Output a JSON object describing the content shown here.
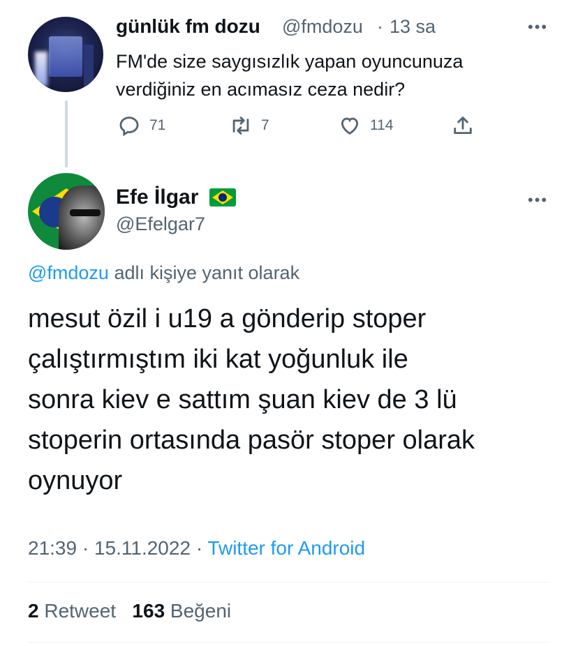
{
  "parent_tweet": {
    "display_name": "günlük fm dozu",
    "handle": "@fmdozu",
    "separator": "·",
    "time": "13 sa",
    "more_icon": "more-icon",
    "text_line1": "FM'de size saygısızlık yapan oyuncunuza",
    "text_line2": "verdiğiniz en acımasız ceza nedir?",
    "actions": {
      "reply_count": "71",
      "retweet_count": "7",
      "like_count": "114"
    }
  },
  "main_tweet": {
    "display_name": "Efe İlgar",
    "flag_icon": "brazil-flag-icon",
    "handle": "@Efelgar7",
    "reply_to_handle": "@fmdozu",
    "reply_to_suffix": " adlı kişiye yanıt olarak",
    "text_lines": [
      "mesut özil i u19 a gönderip stoper",
      "çalıştırmıştım iki kat yoğunluk ile",
      "sonra kiev e sattım şuan kiev de 3 lü",
      "stoperin ortasında pasör stoper olarak",
      "oynuyor"
    ],
    "time": "21:39",
    "date": "15.11.2022",
    "separator": "·",
    "source": "Twitter for Android",
    "retweet_count": "2",
    "retweet_label": "Retweet",
    "like_count": "163",
    "like_label": "Beğeni"
  },
  "colors": {
    "text": "#0f1419",
    "secondary": "#536471",
    "link": "#1d9bf0",
    "divider": "#eff3f4"
  }
}
